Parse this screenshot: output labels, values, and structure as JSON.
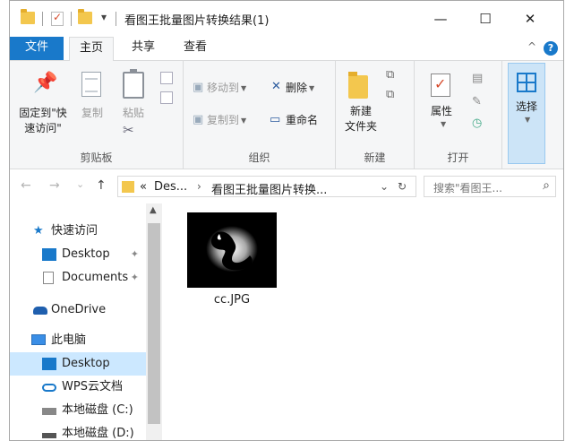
{
  "title_bar": {
    "title": "看图王批量图片转换结果(1)",
    "minimize_glyph": "—",
    "maximize_glyph": "☐",
    "close_glyph": "✕",
    "qa_dropdown_glyph": "▾"
  },
  "ribbon_tabs": {
    "file": "文件",
    "home": "主页",
    "share": "共享",
    "view": "查看",
    "collapse_glyph": "^",
    "help_glyph": "?"
  },
  "ribbon": {
    "clipboard": {
      "group_label": "剪贴板",
      "pin_label_line1": "固定到\"快",
      "pin_label_line2": "速访问\"",
      "copy": "复制",
      "paste": "粘贴"
    },
    "organize": {
      "group_label": "组织",
      "move_to": "移动到",
      "copy_to": "复制到",
      "delete": "删除",
      "rename": "重命名"
    },
    "new": {
      "group_label": "新建",
      "new_folder_line1": "新建",
      "new_folder_line2": "文件夹"
    },
    "open": {
      "group_label": "打开",
      "properties": "属性"
    },
    "select": {
      "label": "选择"
    }
  },
  "address": {
    "back_glyph": "←",
    "forward_glyph": "→",
    "recent_glyph": "⌄",
    "up_glyph": "↑",
    "overflow": "«",
    "crumb1": "Des...",
    "separator": "›",
    "crumb2": "看图王批量图片转换...",
    "dropdown_glyph": "⌄",
    "refresh_glyph": "↻",
    "search_placeholder": "搜索\"看图王...",
    "search_glyph": "⌕"
  },
  "nav_pane": {
    "items": [
      {
        "label": "快速访问"
      },
      {
        "label": "Desktop"
      },
      {
        "label": "Documents"
      },
      {
        "label": "OneDrive"
      },
      {
        "label": "此电脑"
      },
      {
        "label": "Desktop"
      },
      {
        "label": "WPS云文档"
      },
      {
        "label": "本地磁盘 (C:)"
      },
      {
        "label": "本地磁盘 (D:)"
      }
    ],
    "pin_glyph": "✦",
    "scroll_up_glyph": "▲"
  },
  "content": {
    "files": [
      {
        "name": "cc.JPG"
      }
    ]
  },
  "colors": {
    "accent": "#1979ca",
    "folder": "#f3c74e",
    "selected": "#cce8ff"
  }
}
